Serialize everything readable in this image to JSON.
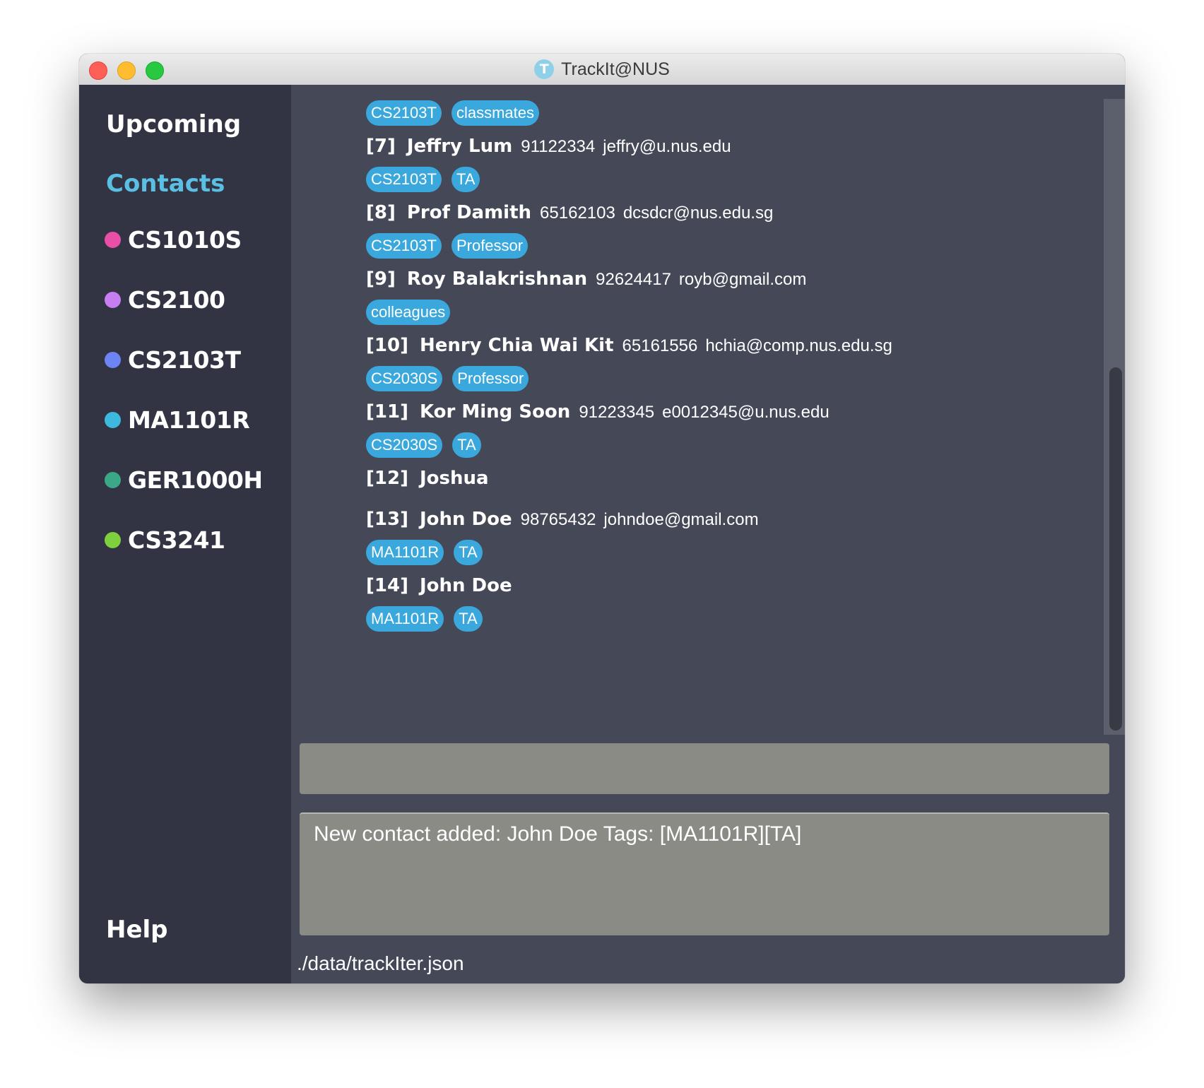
{
  "window": {
    "title": "TrackIt@NUS",
    "app_icon_letter": "T"
  },
  "sidebar": {
    "upcoming_label": "Upcoming",
    "contacts_label": "Contacts",
    "help_label": "Help",
    "modules": [
      {
        "code": "CS1010S",
        "color": "#e94fa6"
      },
      {
        "code": "CS2100",
        "color": "#c67ef0"
      },
      {
        "code": "CS2103T",
        "color": "#6c84f4"
      },
      {
        "code": "MA1101R",
        "color": "#3db8de"
      },
      {
        "code": "GER1000H",
        "color": "#3aa887"
      },
      {
        "code": "CS3241",
        "color": "#7fd03d"
      }
    ]
  },
  "contacts": {
    "partial_top_tags": [
      "CS2103T",
      "classmates"
    ],
    "items": [
      {
        "index": "[7]",
        "name": "Jeffry Lum",
        "phone": "91122334",
        "email": "jeffry@u.nus.edu",
        "tags": [
          "CS2103T",
          "TA"
        ]
      },
      {
        "index": "[8]",
        "name": "Prof Damith",
        "phone": "65162103",
        "email": "dcsdcr@nus.edu.sg",
        "tags": [
          "CS2103T",
          "Professor"
        ]
      },
      {
        "index": "[9]",
        "name": "Roy Balakrishnan",
        "phone": "92624417",
        "email": "royb@gmail.com",
        "tags": [
          "colleagues"
        ]
      },
      {
        "index": "[10]",
        "name": "Henry Chia Wai Kit",
        "phone": "65161556",
        "email": "hchia@comp.nus.edu.sg",
        "tags": [
          "CS2030S",
          "Professor"
        ]
      },
      {
        "index": "[11]",
        "name": "Kor Ming Soon",
        "phone": "91223345",
        "email": "e0012345@u.nus.edu",
        "tags": [
          "CS2030S",
          "TA"
        ]
      },
      {
        "index": "[12]",
        "name": "Joshua",
        "phone": "",
        "email": "",
        "tags": []
      },
      {
        "index": "[13]",
        "name": "John Doe",
        "phone": "98765432",
        "email": "johndoe@gmail.com",
        "tags": [
          "MA1101R",
          "TA"
        ]
      },
      {
        "index": "[14]",
        "name": "John Doe",
        "phone": "",
        "email": "",
        "tags": [
          "MA1101R",
          "TA"
        ]
      }
    ]
  },
  "command": {
    "value": ""
  },
  "result": {
    "message": "New contact added: John Doe Tags: [MA1101R][TA]"
  },
  "status": {
    "file_path": "./data/trackIter.json"
  },
  "colors": {
    "sidebar_bg": "#323443",
    "content_bg": "#444857",
    "accent": "#5bbfe4",
    "tag_bg": "#3aa8dc",
    "box_bg": "#8b8b86"
  }
}
